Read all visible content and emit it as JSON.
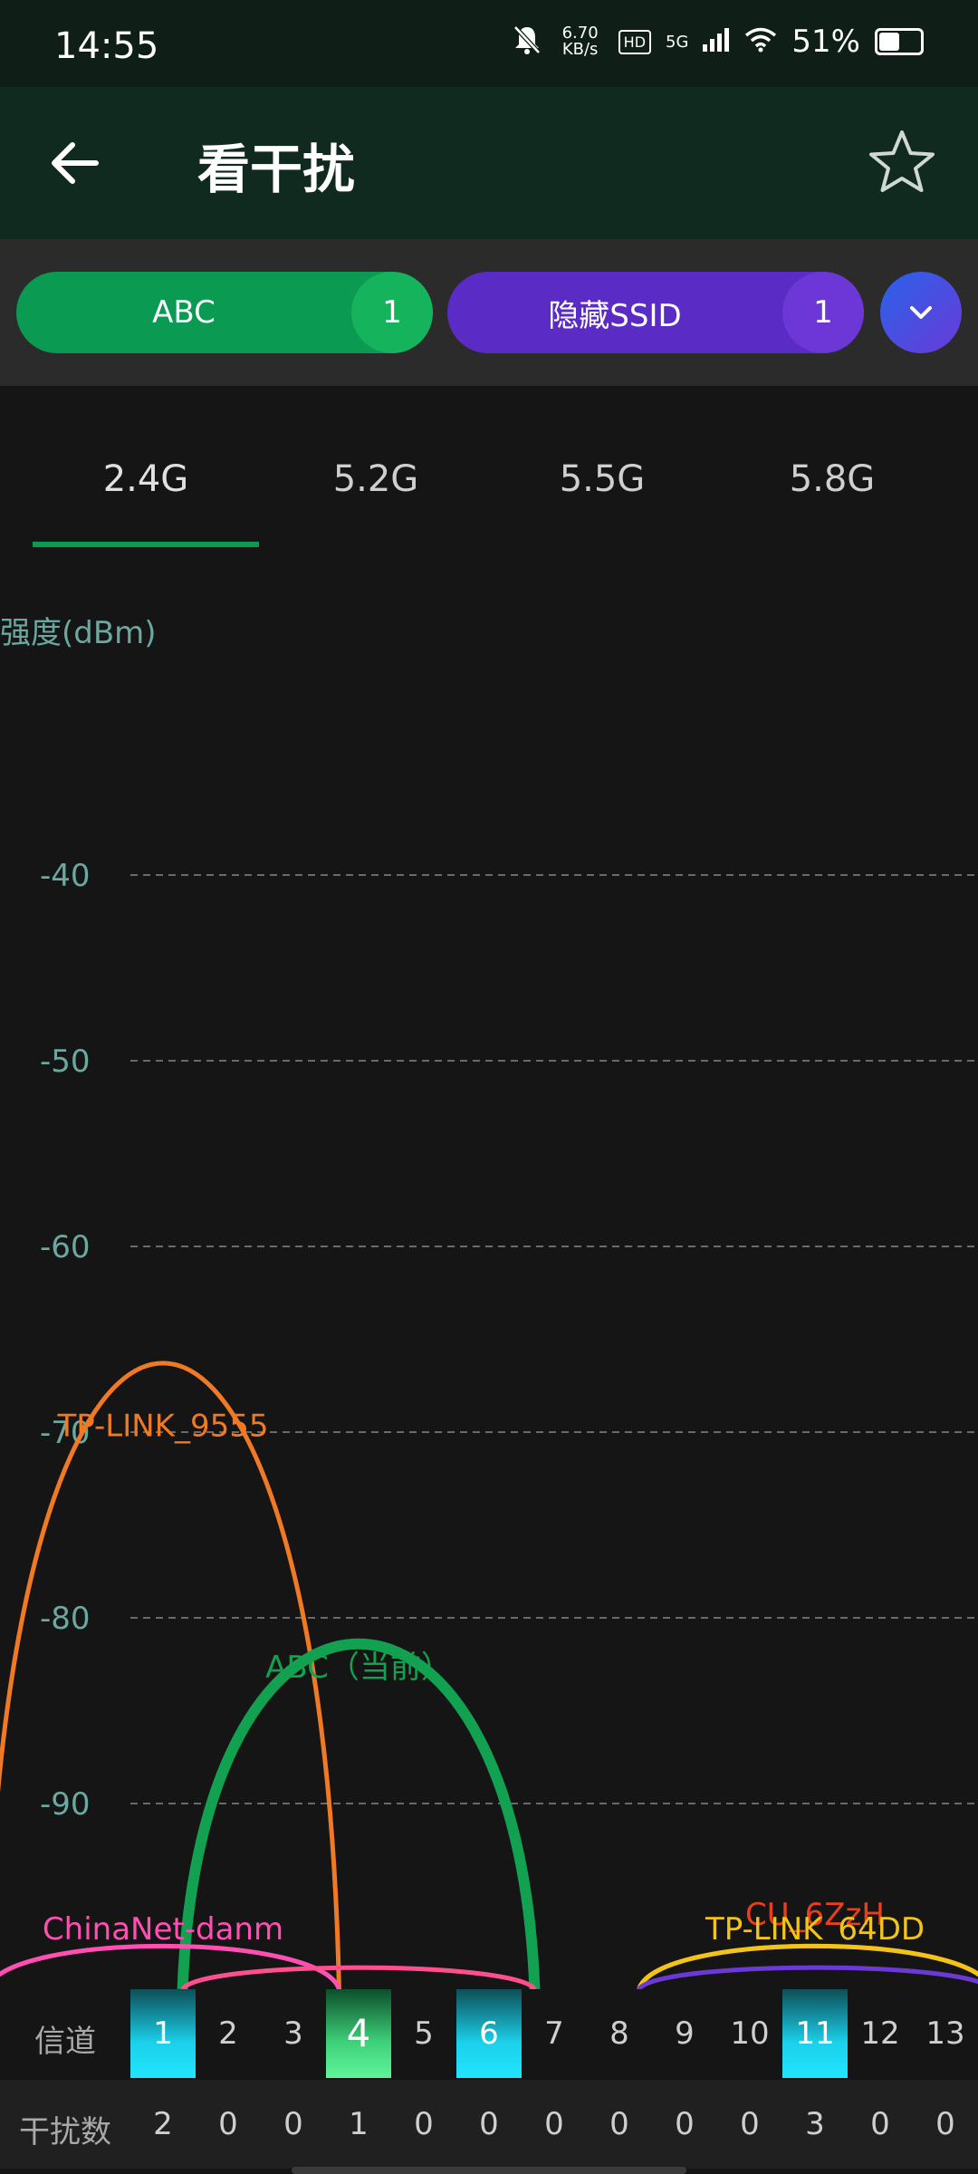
{
  "status_bar": {
    "time": "14:55",
    "speed_value": "6.70",
    "speed_unit": "KB/s",
    "hd": "HD",
    "network": "5G",
    "battery": "51%"
  },
  "header": {
    "title": "看干扰"
  },
  "chips": [
    {
      "label": "ABC",
      "count": "1",
      "color": "#0a9a52"
    },
    {
      "label": "隐藏SSID",
      "count": "1",
      "color": "#5b2bc6"
    }
  ],
  "tabs": [
    "2.4G",
    "5.2G",
    "5.5G",
    "5.8G"
  ],
  "active_tab": "2.4G",
  "chart_data": {
    "type": "line",
    "ylabel": "强度(dBm)",
    "yticks": [
      -40,
      -50,
      -60,
      -70,
      -80,
      -90
    ],
    "ylim": [
      -100,
      -40
    ],
    "x_channels": [
      1,
      2,
      3,
      4,
      5,
      6,
      7,
      8,
      9,
      10,
      11,
      12,
      13
    ],
    "grid": true,
    "series": [
      {
        "name": "TP-LINK_9555",
        "channel": 1,
        "peak_dbm": -71,
        "color": "#f07a23"
      },
      {
        "name": "ABC（当前）",
        "channel": 4,
        "peak_dbm": -84,
        "color": "#12a150"
      },
      {
        "name": "ChinaNet-danm",
        "channel": 1,
        "peak_dbm": -98,
        "color": "#ff4fb2"
      },
      {
        "name": "CU_6ZzH",
        "channel": 11,
        "peak_dbm": -98,
        "color": "#e8401c"
      },
      {
        "name": "TP-LINK_64DD",
        "channel": 11,
        "peak_dbm": -98,
        "color": "#f0c419"
      }
    ],
    "unlabeled_curves": [
      {
        "channel": 4,
        "peak_dbm": -99,
        "color": "#ff4f8f"
      },
      {
        "channel": 11,
        "peak_dbm": -99,
        "color": "#6b3ad6"
      }
    ]
  },
  "channel_table": {
    "channel_label": "信道",
    "interference_label": "干扰数",
    "channels": [
      "1",
      "2",
      "3",
      "4",
      "5",
      "6",
      "7",
      "8",
      "9",
      "10",
      "11",
      "12",
      "13"
    ],
    "interference": [
      "2",
      "0",
      "0",
      "1",
      "0",
      "0",
      "0",
      "0",
      "0",
      "0",
      "3",
      "0",
      "0"
    ],
    "highlight_cyan": [
      1,
      6,
      11
    ],
    "highlight_green": [
      4
    ]
  }
}
